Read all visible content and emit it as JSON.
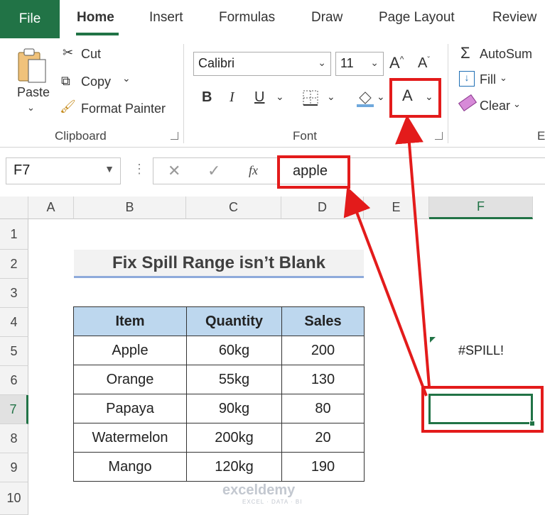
{
  "tabs": {
    "file": "File",
    "home": "Home",
    "insert": "Insert",
    "formulas": "Formulas",
    "draw": "Draw",
    "page_layout": "Page Layout",
    "review": "Review"
  },
  "clipboard": {
    "paste": "Paste",
    "cut": "Cut",
    "copy": "Copy",
    "format_painter": "Format Painter",
    "label": "Clipboard"
  },
  "font": {
    "name": "Calibri",
    "size": "11",
    "label": "Font",
    "bold": "B",
    "italic": "I",
    "underline": "U",
    "font_color": "A"
  },
  "editing": {
    "autosum": "AutoSum",
    "fill": "Fill",
    "clear": "Clear",
    "label": "E"
  },
  "formula_bar": {
    "name_box": "F7",
    "fx": "fx",
    "value": "apple"
  },
  "columns": [
    "A",
    "B",
    "C",
    "D",
    "E",
    "F"
  ],
  "rows": [
    "1",
    "2",
    "3",
    "4",
    "5",
    "6",
    "7",
    "8",
    "9",
    "10"
  ],
  "sheet": {
    "title": "Fix Spill Range isn’t Blank",
    "headers": [
      "Item",
      "Quantity",
      "Sales"
    ],
    "rows": [
      [
        "Apple",
        "60kg",
        "200"
      ],
      [
        "Orange",
        "55kg",
        "130"
      ],
      [
        "Papaya",
        "90kg",
        "80"
      ],
      [
        "Watermelon",
        "200kg",
        "20"
      ],
      [
        "Mango",
        "120kg",
        "190"
      ]
    ],
    "spill_error": "#SPILL!"
  },
  "watermark": {
    "name": "exceldemy",
    "tagline": "EXCEL · DATA · BI"
  },
  "colors": {
    "excel_green": "#217346",
    "header_fill": "#bdd7ee",
    "highlight": "#e31b1b"
  }
}
